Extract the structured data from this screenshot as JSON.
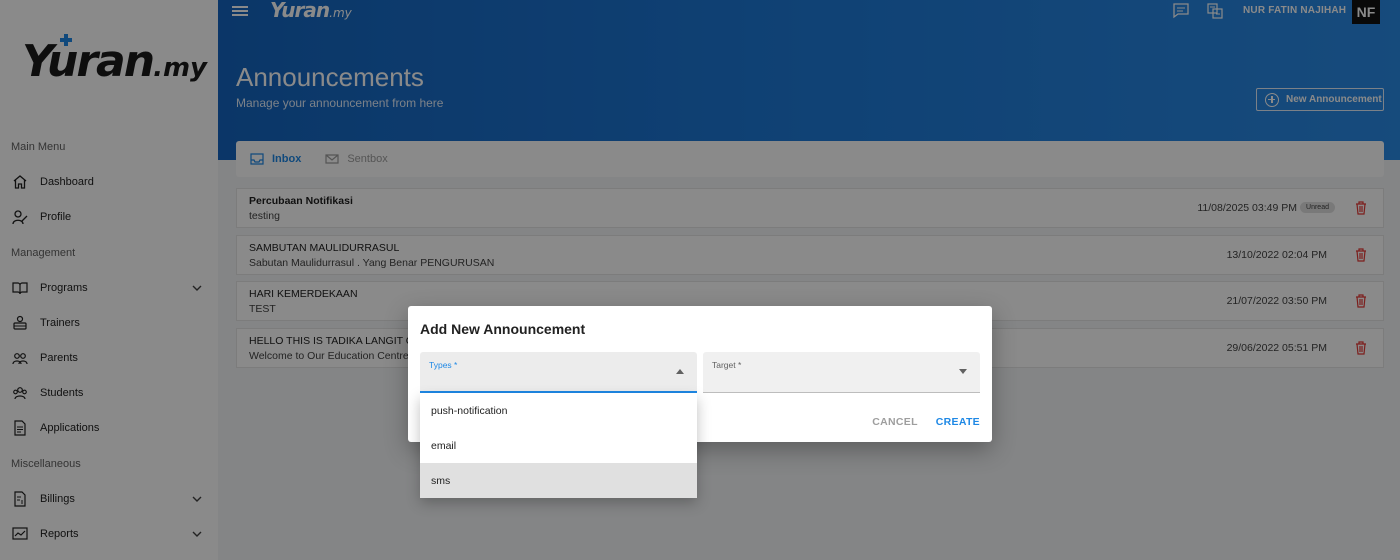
{
  "app": {
    "brand": "Yuran",
    "brand_suffix": ".my"
  },
  "sidebar": {
    "sections": {
      "main": "Main Menu",
      "management": "Management",
      "misc": "Miscellaneous"
    },
    "items": [
      {
        "label": "Dashboard",
        "icon": "home-icon"
      },
      {
        "label": "Profile",
        "icon": "profile-icon"
      },
      {
        "label": "Programs",
        "icon": "book-icon",
        "expandable": true
      },
      {
        "label": "Trainers",
        "icon": "trainer-icon"
      },
      {
        "label": "Parents",
        "icon": "people-icon"
      },
      {
        "label": "Students",
        "icon": "students-icon"
      },
      {
        "label": "Applications",
        "icon": "document-icon"
      },
      {
        "label": "Billings",
        "icon": "billing-icon",
        "expandable": true
      },
      {
        "label": "Reports",
        "icon": "report-icon",
        "expandable": true
      }
    ]
  },
  "header": {
    "user_name": "NUR FATIN NAJIHAH",
    "avatar_initials": "NF",
    "title": "Announcements",
    "subtitle": "Manage your announcement from here",
    "new_button": "New Announcement"
  },
  "tabs": [
    {
      "label": "Inbox",
      "active": true,
      "icon": "inbox-icon"
    },
    {
      "label": "Sentbox",
      "active": false,
      "icon": "mail-icon"
    }
  ],
  "messages": [
    {
      "subject": "Percubaan Notifikasi",
      "body": "testing",
      "date": "11/08/2025 03:49 PM",
      "badge": "Unread",
      "bold": true
    },
    {
      "subject": "SAMBUTAN MAULIDURRASUL",
      "body": "Sabutan Maulidurrasul . Yang Benar PENGURUSAN",
      "date": "13/10/2022 02:04 PM",
      "badge": "",
      "bold": false
    },
    {
      "subject": "HARI KEMERDEKAAN",
      "body": "TEST",
      "date": "21/07/2022 03:50 PM",
      "badge": "",
      "bold": false
    },
    {
      "subject": "HELLO THIS IS TADIKA LANGIT CEN",
      "body": "Welcome to Our Education Centre f",
      "date": "29/06/2022 05:51 PM",
      "badge": "",
      "bold": false
    }
  ],
  "dialog": {
    "title": "Add New Announcement",
    "types_label": "Types *",
    "target_label": "Target *",
    "cancel": "CANCEL",
    "create": "CREATE",
    "options": [
      "push-notification",
      "email",
      "sms"
    ],
    "hovered_option": "sms"
  },
  "colors": {
    "accent": "#1e88e5",
    "header": "#1e7ad8",
    "delete": "#e53935"
  }
}
